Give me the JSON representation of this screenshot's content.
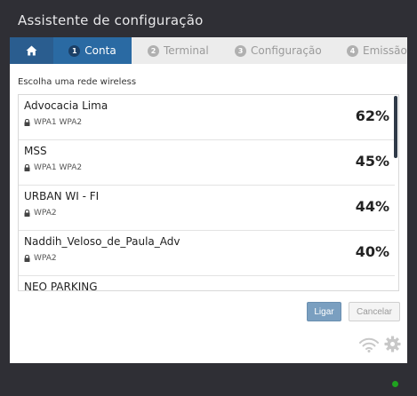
{
  "window": {
    "title": "Assistente de configuração"
  },
  "tabs": [
    {
      "icon": "home-icon"
    },
    {
      "number": "1",
      "label": "Conta",
      "active": true
    },
    {
      "number": "2",
      "label": "Terminal",
      "active": false
    },
    {
      "number": "3",
      "label": "Configuração",
      "active": false
    },
    {
      "number": "4",
      "label": "Emissão",
      "active": false
    }
  ],
  "wifi": {
    "prompt": "Escolha uma rede wireless",
    "networks": [
      {
        "ssid": "Advocacia Lima",
        "security": "WPA1 WPA2",
        "signal": "62%"
      },
      {
        "ssid": "MSS",
        "security": "WPA1 WPA2",
        "signal": "45%"
      },
      {
        "ssid": "URBAN WI - FI",
        "security": "WPA2",
        "signal": "44%"
      },
      {
        "ssid": "Naddih_Veloso_de_Paula_Adv",
        "security": "WPA2",
        "signal": "40%"
      },
      {
        "ssid": "NEO PARKING",
        "security": "",
        "signal": ""
      }
    ]
  },
  "actions": {
    "connect_label": "Ligar",
    "cancel_label": "Cancelar"
  },
  "footer_icons": [
    "wifi-icon",
    "gear-icon"
  ],
  "colors": {
    "accent": "#2a6aa3",
    "status": "#1fa31f"
  }
}
